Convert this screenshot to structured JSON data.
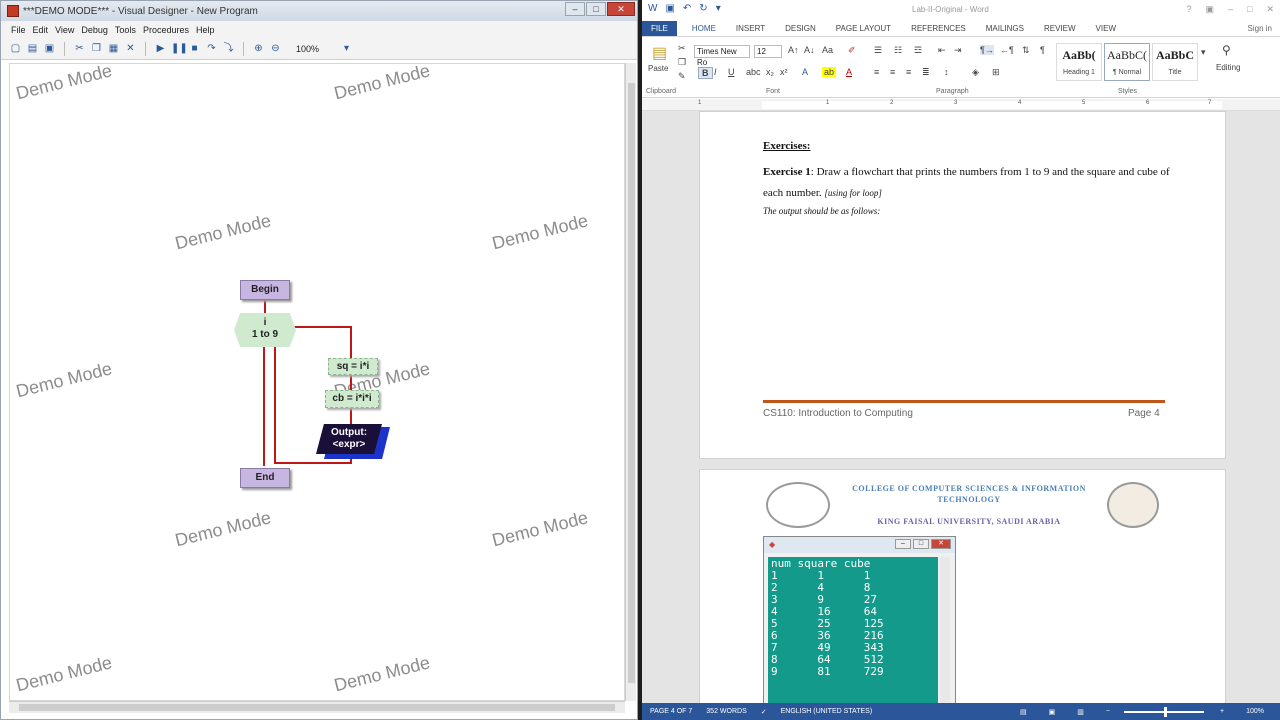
{
  "designer": {
    "title": "***DEMO MODE*** - Visual Designer - New Program",
    "menu": [
      "File",
      "Edit",
      "View",
      "Debug",
      "Tools",
      "Procedures",
      "Help"
    ],
    "zoom": "100%",
    "watermark": "Demo Mode",
    "flowchart": {
      "begin": "Begin",
      "loop_var": "i",
      "loop_range": "1 to 9",
      "assign1": "sq = i*i",
      "assign2": "cb = i*i*i",
      "output_label": "Output:",
      "output_expr": "<expr>",
      "end": "End"
    }
  },
  "word": {
    "title": "Lab-II-Original - Word",
    "signin": "Sign in",
    "tabs": [
      "FILE",
      "HOME",
      "INSERT",
      "DESIGN",
      "PAGE LAYOUT",
      "REFERENCES",
      "MAILINGS",
      "REVIEW",
      "VIEW"
    ],
    "ribbon": {
      "paste": "Paste",
      "font_name": "Times New Ro",
      "font_size": "12",
      "clipboard": "Clipboard",
      "font": "Font",
      "paragraph": "Paragraph",
      "styles": "Styles",
      "editing": "Editing",
      "style_boxes": [
        {
          "sample": "AaBb(",
          "name": "Heading 1"
        },
        {
          "sample": "AaBbC(",
          "name": "¶ Normal"
        },
        {
          "sample": "AaBbC",
          "name": "Title"
        }
      ]
    },
    "doc": {
      "exercises_heading": "Exercises:",
      "exercise1_label": "Exercise 1",
      "exercise1_text": ": Draw a flowchart that prints the numbers from 1 to 9 and the square and cube of each number. ",
      "exercise1_hint": "[using for loop]",
      "output_intro": "The output should be as follows:",
      "footer_left": "CS110: Introduction to Computing",
      "footer_right": "Page 4",
      "college_line1": "COLLEGE OF COMPUTER SCIENCES & INFORMATION",
      "college_line2": "TECHNOLOGY",
      "university": "KING FAISAL UNIVERSITY, SAUDI ARABIA",
      "console_output": "num square cube\n1      1      1\n2      4      8\n3      9      27\n4      16     64\n5      25     125\n6      36     216\n7      49     343\n8      64     512\n9      81     729"
    },
    "status": {
      "page": "PAGE 4 OF 7",
      "words": "352 WORDS",
      "language": "ENGLISH (UNITED STATES)",
      "zoom": "100%"
    }
  }
}
